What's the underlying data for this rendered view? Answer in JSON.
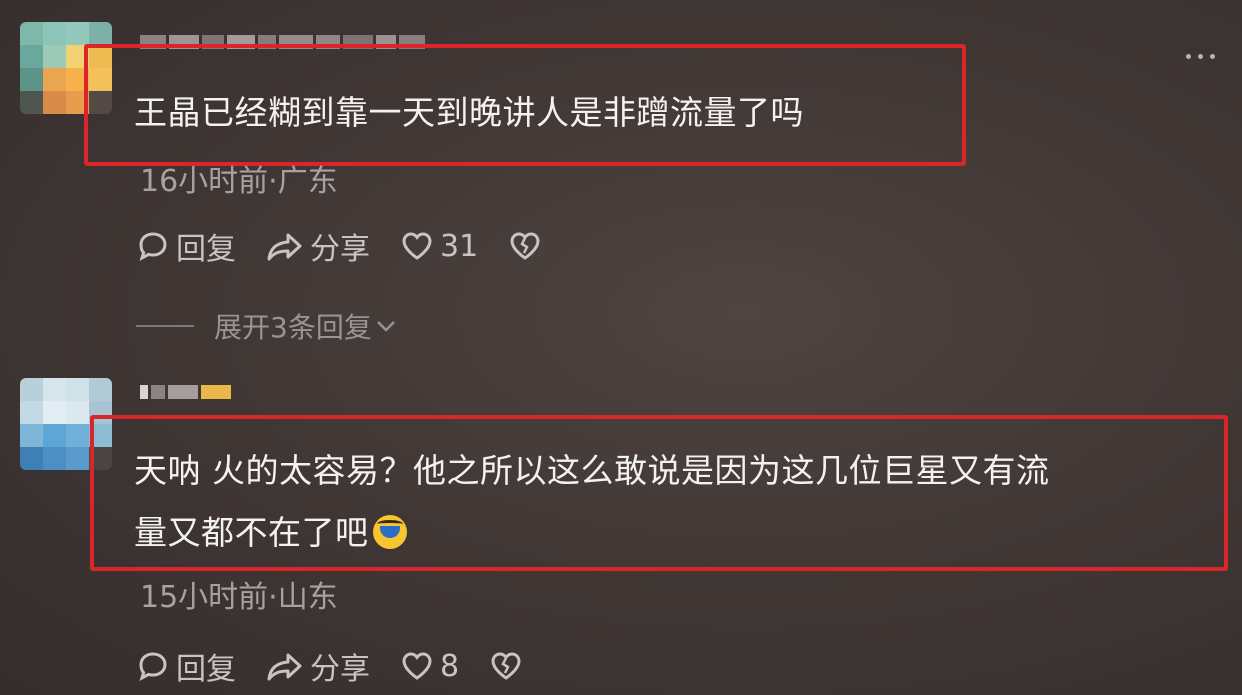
{
  "comments": [
    {
      "text": "王晶已经糊到靠一天到晚讲人是非蹭流量了吗",
      "meta": "16小时前·广东",
      "reply_label": "回复",
      "share_label": "分享",
      "like_count": "31",
      "expand_label": "展开3条回复"
    },
    {
      "text_line1": "天呐 火的太容易？他之所以这么敢说是因为这几位巨星又有流",
      "text_line2": "量又都不在了吧",
      "emoji": "crying-laughing-emoji",
      "meta": "15小时前·山东",
      "reply_label": "回复",
      "share_label": "分享",
      "like_count": "8"
    }
  ],
  "colors": {
    "background": "#3f3634",
    "highlight_border": "#d8262b",
    "text": "#f4f2f1",
    "meta_text": "#a8a19f"
  },
  "icons": [
    "comment-bubble-icon",
    "share-arrow-icon",
    "heart-icon",
    "broken-heart-icon",
    "more-dots-icon",
    "chevron-down-icon"
  ]
}
